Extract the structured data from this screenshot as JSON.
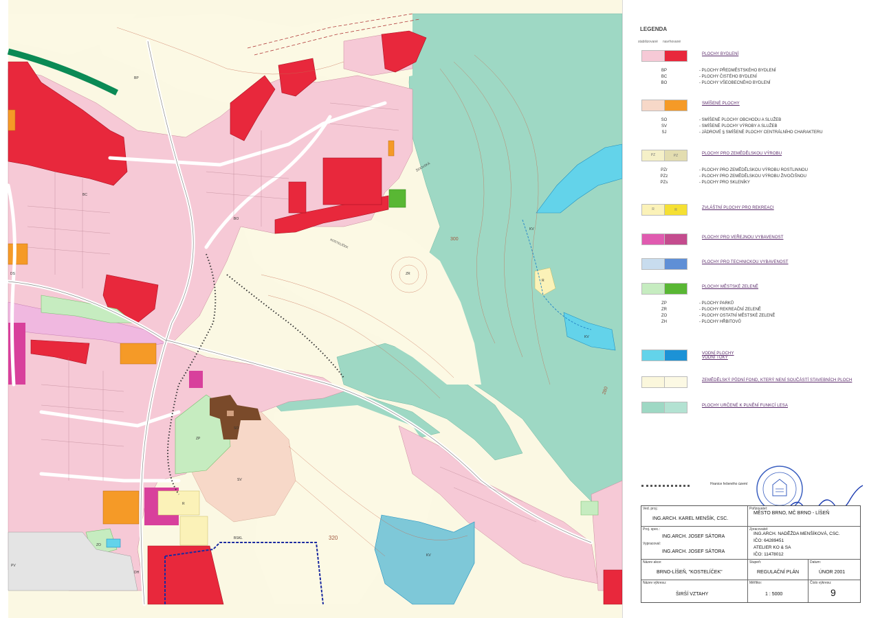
{
  "legend": {
    "title": "LEGENDA",
    "col_existing": "stabilizované",
    "col_proposed": "navrhované",
    "categories": [
      {
        "label": "PLOCHY BYDLENÍ",
        "color_existing": "#f6c9d6",
        "color_proposed": "#e8283c",
        "code_existing": "",
        "code_proposed": "",
        "items": [
          {
            "code": "BP",
            "desc": "- PLOCHY PŘEDMĚSTSKÉHO BYDLENÍ"
          },
          {
            "code": "BC",
            "desc": "- PLOCHY ČISTÉHO BYDLENÍ"
          },
          {
            "code": "BO",
            "desc": "- PLOCHY VŠEOBECNÉHO BYDLENÍ"
          }
        ]
      },
      {
        "label": "SMÍŠENÉ PLOCHY",
        "color_existing": "#f7d8c8",
        "color_proposed": "#f59a27",
        "code_existing": "",
        "code_proposed": "",
        "items": [
          {
            "code": "SO",
            "desc": "- SMÍŠENÉ PLOCHY OBCHODU A SLUŽEB"
          },
          {
            "code": "SV",
            "desc": "- SMÍŠENÉ PLOCHY VÝROBY A SLUŽEB"
          },
          {
            "code": "SJ",
            "desc": "- JÁDROVÉ § SMÍŠENÉ PLOCHY CENTRÁLNÍHO CHARAKTERU"
          }
        ]
      },
      {
        "label": "PLOCHY PRO ZEMĚDĚLSKOU VÝROBU",
        "color_existing": "#f5f0c8",
        "color_proposed": "#e3ddb0",
        "code_existing": "PZ",
        "code_proposed": "PZ",
        "items": [
          {
            "code": "PZr",
            "desc": "- PLOCHY PRO ZEMĚDĚLSKOU VÝROBU ROSTLINNOU"
          },
          {
            "code": "PZz",
            "desc": "- PLOCHY PRO ZEMĚDĚLSKOU VÝROBU ŽIVOČIŠNOU"
          },
          {
            "code": "PZs",
            "desc": "- PLOCHY PRO SKLENÍKY"
          }
        ]
      },
      {
        "label": "ZVLÁŠTNÍ PLOCHY PRO REKREACI",
        "color_existing": "#fbf2b8",
        "color_proposed": "#f5e033",
        "code_existing": "R",
        "code_proposed": "R",
        "items": []
      },
      {
        "label": "PLOCHY PRO VEŘEJNOU VYBAVENOST",
        "color_existing": "#e05bb0",
        "color_proposed": "#c44c8e",
        "code_existing": "",
        "code_proposed": "",
        "items": []
      },
      {
        "label": "PLOCHY PRO TECHNICKOU VYBAVENOST",
        "color_existing": "#c8dcee",
        "color_proposed": "#5f8fd6",
        "code_existing": "",
        "code_proposed": "",
        "items": []
      },
      {
        "label": "PLOCHY MĚSTSKÉ ZELENĚ",
        "color_existing": "#c6ecc0",
        "color_proposed": "#59b734",
        "code_existing": "",
        "code_proposed": "",
        "items": [
          {
            "code": "ZP",
            "desc": "- PLOCHY PARKŮ"
          },
          {
            "code": "ZR",
            "desc": "- PLOCHY REKREAČNÍ ZELENĚ"
          },
          {
            "code": "ZO",
            "desc": "- PLOCHY OSTATNÍ MĚSTSKÉ ZELENĚ"
          },
          {
            "code": "ZH",
            "desc": "- PLOCHY HŘBITOVŮ"
          }
        ]
      },
      {
        "label": "VODNÍ PLOCHY\nVODNÍ TOKY",
        "color_existing": "#63d3ea",
        "color_proposed": "#1c92d6",
        "code_existing": "",
        "code_proposed": "",
        "items": []
      },
      {
        "label": "ZEMĚDĚLSKÝ PŮDNÍ FOND, KTERÝ NENÍ SOUČÁSTÍ STAVEBNÍCH PLOCH",
        "color_existing": "#fbf7dc",
        "color_proposed": "#fcf9e4",
        "code_existing": "",
        "code_proposed": "",
        "items": []
      },
      {
        "label": "PLOCHY URČENÉ K PLNĚNÍ FUNKCÍ LESA",
        "color_existing": "#9ed8c4",
        "color_proposed": "#b3e2d2",
        "code_existing": "",
        "code_proposed": "",
        "items": []
      }
    ],
    "boundary_label": "Hranice řešeného území"
  },
  "title_block": {
    "ved_proj_label": "Ved. proj.:",
    "ved_proj_value": "ING.ARCH. KAREL MENŠÍK, CSC.",
    "porizovatel_label": "Pořizovatel:",
    "porizovatel_value": "MĚSTO BRNO, MČ BRNO - LÍŠEŇ",
    "proj_spec_label": "Proj. spec.:",
    "proj_spec_value": "ING.ARCH. JOSEF SÁTORA",
    "vypracoval_label": "Vypracoval:",
    "vypracoval_value": "ING.ARCH. JOSEF SÁTORA",
    "zpracovatel_label": "Zpracovatel:",
    "zpracovatel_lines": [
      "ING.ARCH. NADĚŽDA MENŠÍKOVÁ, CSC.",
      "IČO: 64289451",
      "ATELIER KO & SA",
      "IČO: 11478012"
    ],
    "nazev_akce_label": "Název akce:",
    "nazev_akce_value": "BRNO-LÍŠEŇ, \"KOSTELÍČEK\"",
    "stupen_label": "Stupeň:",
    "stupen_value": "REGULAČNÍ PLÁN",
    "datum_label": "Datum:",
    "datum_value": "ÚNOR 2001",
    "nazev_vykresu_label": "Název výkresu:",
    "nazev_vykresu_value": "ŠIRŠÍ VZTAHY",
    "meritko_label": "Měřítko:",
    "meritko_value": "1 : 5000",
    "cislo_label": "Číslo výkresu:",
    "cislo_value": "9"
  },
  "map": {
    "contour_labels": [
      "320",
      "280",
      "360",
      "300"
    ],
    "zone_labels": [
      "BP",
      "BC",
      "BO",
      "SO",
      "SV",
      "ZP",
      "ZO",
      "ZR",
      "KV",
      "R",
      "DH",
      "PV",
      "DS"
    ],
    "street_labels": [
      "ŽIDOVSKÁ",
      "KOSTELÍČEK",
      "BSKL"
    ]
  },
  "stamp": {
    "text": "AUTORIZOVANÝ ARCHITEKT"
  }
}
